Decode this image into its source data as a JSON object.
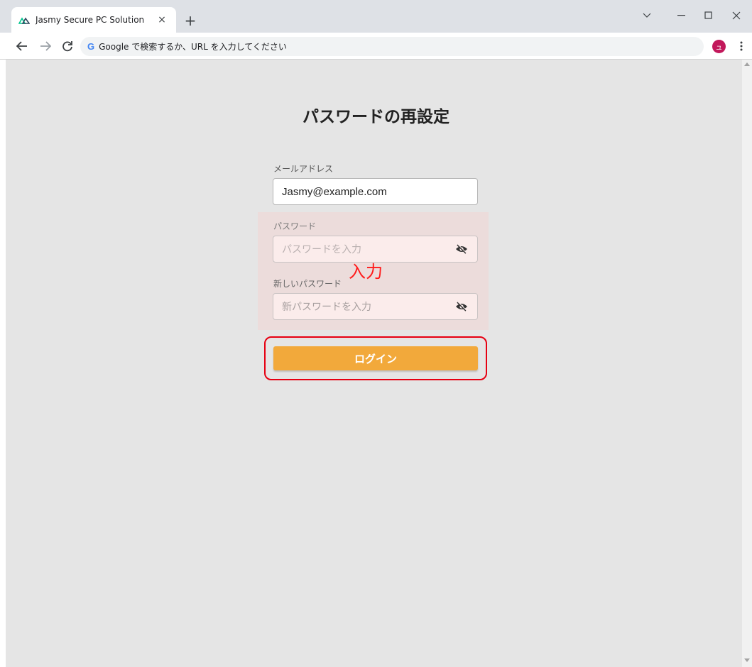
{
  "browser": {
    "tab_title": "Jasmy Secure PC Solution",
    "tab_close": "×",
    "new_tab": "+",
    "omnibox_text": "Google で検索するか、URL を入力してください",
    "google_g": "G",
    "avatar_letter": "ュ"
  },
  "page": {
    "title": "パスワードの再設定",
    "email": {
      "label": "メールアドレス",
      "value": "Jasmy@example.com"
    },
    "password": {
      "label": "パスワード",
      "placeholder": "パスワードを入力"
    },
    "new_password": {
      "label": "新しいパスワード",
      "placeholder": "新パスワードを入力"
    },
    "annotation": "入力",
    "login_button": "ログイン"
  },
  "colors": {
    "page_background": "#e5e5e5",
    "button": "#f2a93b",
    "highlight": "#ecdcdb",
    "annotation": "#ff1a1a",
    "avatar": "#c2185b"
  },
  "icons": {
    "favicon": "nuxt-logo-icon",
    "password_toggle": "eye-slash-icon"
  }
}
